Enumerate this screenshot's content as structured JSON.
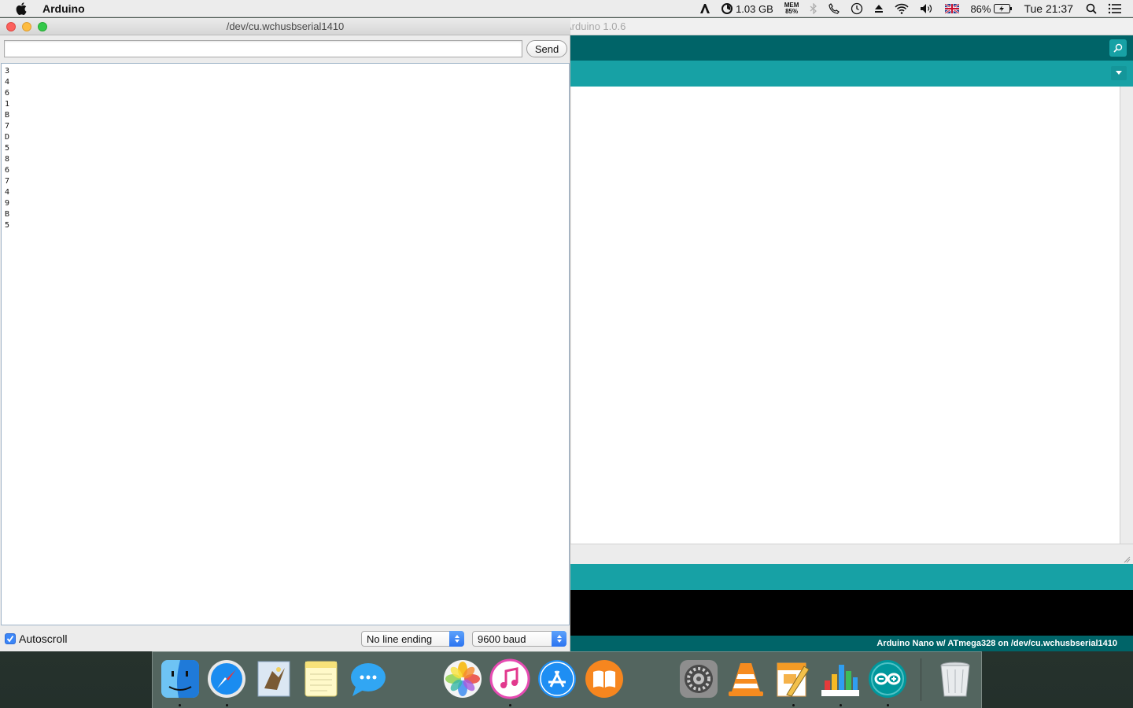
{
  "menubar": {
    "app_name": "Arduino",
    "memory": "1.03 GB",
    "mem_label_top": "MEM",
    "mem_label_bottom": "85%",
    "battery": "86%",
    "clock": "Tue 21:37"
  },
  "ide": {
    "title": "Arduino 1.0.6",
    "footer": "Arduino Nano w/ ATmega328 on /dev/cu.wchusbserial1410"
  },
  "serial_monitor": {
    "title": "/dev/cu.wchusbserial1410",
    "input_value": "",
    "send_label": "Send",
    "output_lines": [
      "3",
      "4",
      "6",
      "1",
      "B",
      "7",
      "D",
      "5",
      "8",
      "6",
      "7",
      "4",
      "9",
      "B",
      "5"
    ],
    "autoscroll_label": "Autoscroll",
    "autoscroll_checked": true,
    "line_ending": "No line ending",
    "baud_rate": "9600 baud"
  },
  "dock": {
    "apps": [
      "finder",
      "safari",
      "mail",
      "notes",
      "messages",
      "photos",
      "itunes",
      "app-store",
      "ibooks",
      "system-preferences",
      "vlc",
      "pages",
      "numbers",
      "arduino",
      "trash"
    ]
  },
  "colors": {
    "arduino_dark": "#006468",
    "arduino_teal": "#17a1a5",
    "mac_blue": "#3b86f7"
  }
}
